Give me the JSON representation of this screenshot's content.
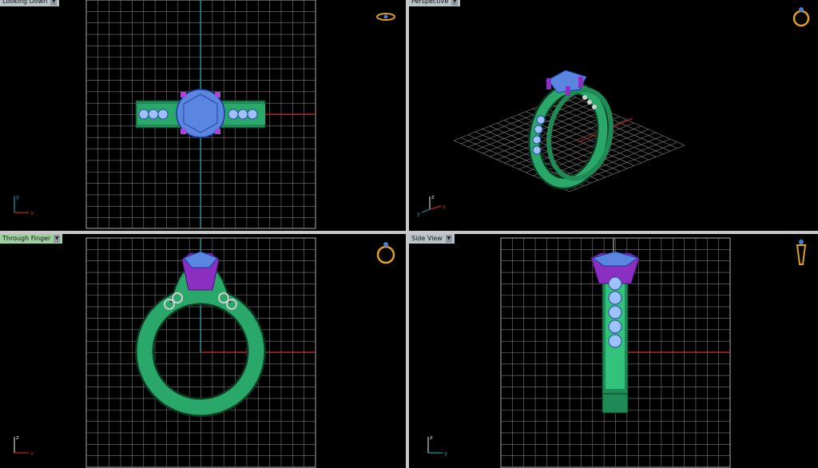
{
  "viewports": {
    "top_left": {
      "label": "Looking Down"
    },
    "top_right": {
      "label": "Perspective"
    },
    "bottom_left": {
      "label": "Through Finger"
    },
    "bottom_right": {
      "label": "Side View"
    }
  },
  "axes": {
    "x": "x",
    "y": "y",
    "z": "z"
  },
  "colors": {
    "grid": "#8a8a8a",
    "axis_x": "#c02020",
    "axis_y": "#1a9aa8",
    "band": "#2aa86a",
    "band_dark": "#155c3a",
    "stone": "#5a86e0",
    "prong": "#8a2fc0",
    "nav_icon": "#e0a020",
    "label_bg": "#b9c4c9",
    "active_label_bg": "#9fd19f"
  },
  "icons": {
    "dropdown": "chevron-down-icon",
    "nav_gizmo": "ring-view-icon"
  }
}
